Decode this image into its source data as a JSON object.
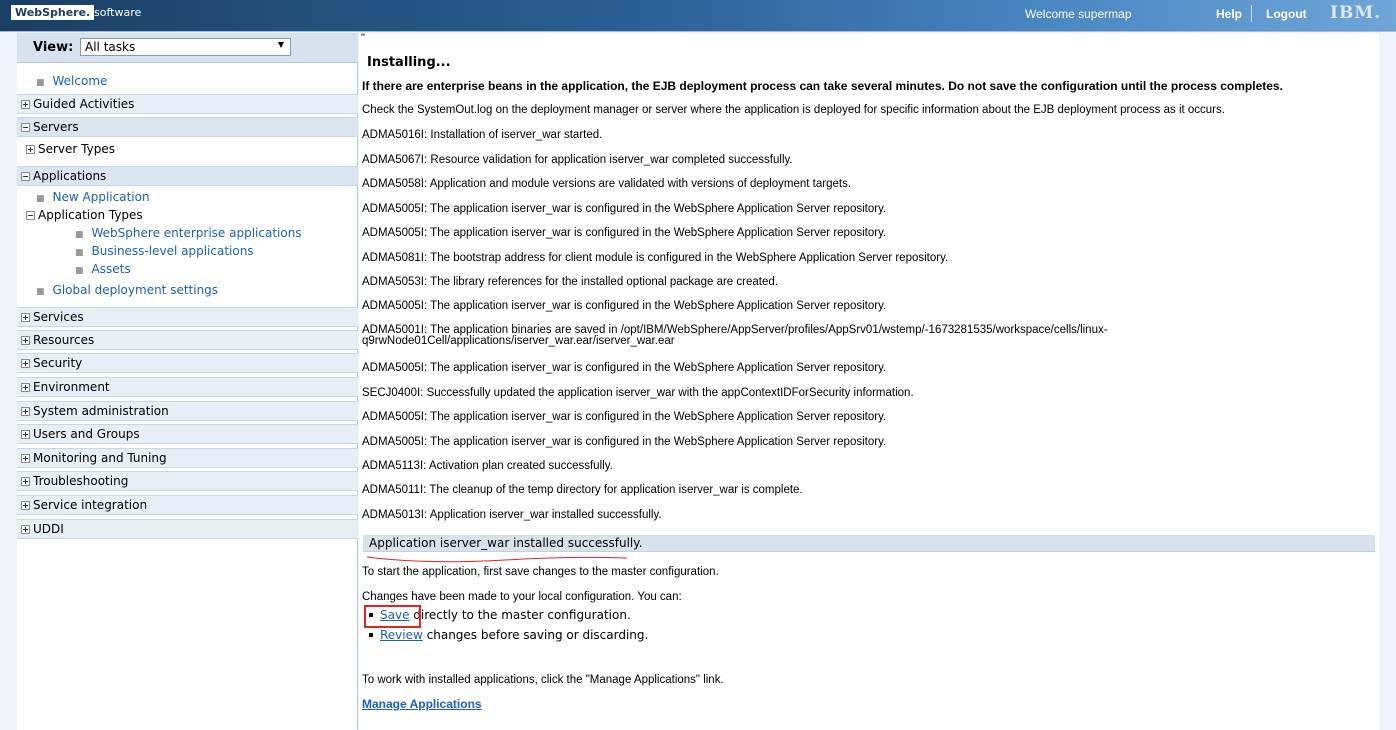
{
  "banner": {
    "brand": "WebSphere.",
    "brand_suffix": "software",
    "welcome": "Welcome supermap",
    "help": "Help",
    "logout": "Logout",
    "ibm": "IBM."
  },
  "nav": {
    "view_label": "View:",
    "view_value": "All tasks",
    "welcome": "Welcome",
    "guided": "Guided Activities",
    "servers": "Servers",
    "server_types": "Server Types",
    "applications": "Applications",
    "new_application": "New Application",
    "application_types": "Application Types",
    "websphere_enterprise": "WebSphere enterprise applications",
    "business_level": "Business-level applications",
    "assets": "Assets",
    "global_deployment": "Global deployment settings",
    "services": "Services",
    "resources": "Resources",
    "security": "Security",
    "environment": "Environment",
    "system_admin": "System administration",
    "users_groups": "Users and Groups",
    "monitoring": "Monitoring and Tuning",
    "troubleshooting": "Troubleshooting",
    "service_integration": "Service integration",
    "uddi": "UDDI"
  },
  "main": {
    "stray": "\"",
    "title": "Installing...",
    "warning": "If there are enterprise beans in the application, the EJB deployment process can take several minutes. Do not save the configuration until the process completes.",
    "messages": [
      "Check the SystemOut.log on the deployment manager or server where the application is deployed for specific information about the EJB deployment process as it occurs.",
      "ADMA5016I: Installation of iserver_war started.",
      "ADMA5067I: Resource validation for application iserver_war completed successfully.",
      "ADMA5058I: Application and module versions are validated with versions of deployment targets.",
      "ADMA5005I: The application iserver_war is configured in the WebSphere Application Server repository.",
      "ADMA5005I: The application iserver_war is configured in the WebSphere Application Server repository.",
      "ADMA5081I: The bootstrap address for client module is configured in the WebSphere Application Server repository.",
      "ADMA5053I: The library references for the installed optional package are created.",
      "ADMA5005I: The application iserver_war is configured in the WebSphere Application Server repository.",
      "ADMA5001I: The application binaries are saved in /opt/IBM/WebSphere/AppServer/profiles/AppSrv01/wstemp/-1673281535/workspace/cells/linux-q9rwNode01Cell/applications/iserver_war.ear/iserver_war.ear",
      "ADMA5005I: The application iserver_war is configured in the WebSphere Application Server repository.",
      "SECJ0400I: Successfully updated the application iserver_war with the appContextIDForSecurity information.",
      "ADMA5005I: The application iserver_war is configured in the WebSphere Application Server repository.",
      "ADMA5005I: The application iserver_war is configured in the WebSphere Application Server repository.",
      "ADMA5113I: Activation plan created successfully.",
      "ADMA5011I: The cleanup of the temp directory for application iserver_war is complete.",
      "ADMA5013I: Application iserver_war installed successfully."
    ],
    "success": "Application iserver_war installed successfully.",
    "start_hint": "To start the application, first save changes to the master configuration.",
    "changes_made": "Changes have been made to your local configuration. You can:",
    "save_link": "Save",
    "save_rest": " directly to the master configuration.",
    "review_link": "Review",
    "review_rest": " changes before saving or discarding.",
    "manage_hint": "To work with installed applications, click the \"Manage Applications\" link.",
    "manage_link": "Manage Applications"
  }
}
